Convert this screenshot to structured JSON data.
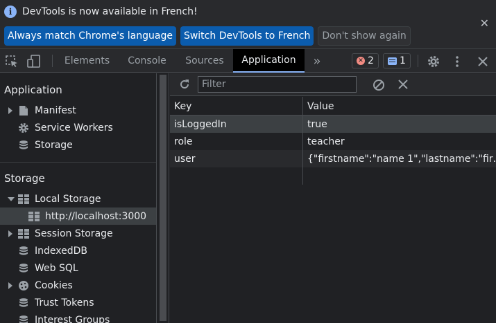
{
  "infobar": {
    "message": "DevTools is now available in French!",
    "buttons": {
      "match_language": "Always match Chrome's language",
      "switch_french": "Switch DevTools to French",
      "dont_show": "Don't show again"
    },
    "close_glyph": "✕"
  },
  "tabs": {
    "elements": "Elements",
    "console": "Console",
    "sources": "Sources",
    "application": "Application",
    "more": "»"
  },
  "badges": {
    "errors": "2",
    "messages": "1"
  },
  "sidebar": {
    "application_title": "Application",
    "application_items": [
      {
        "label": "Manifest",
        "icon": "document-icon"
      },
      {
        "label": "Service Workers",
        "icon": "gear-icon"
      },
      {
        "label": "Storage",
        "icon": "database-icon"
      }
    ],
    "storage_title": "Storage",
    "storage_items": [
      {
        "label": "Local Storage",
        "icon": "grid-icon"
      },
      {
        "label": "http://localhost:3000",
        "icon": "grid-icon"
      },
      {
        "label": "Session Storage",
        "icon": "grid-icon"
      },
      {
        "label": "IndexedDB",
        "icon": "database-icon"
      },
      {
        "label": "Web SQL",
        "icon": "database-icon"
      },
      {
        "label": "Cookies",
        "icon": "cookie-icon"
      },
      {
        "label": "Trust Tokens",
        "icon": "database-icon"
      },
      {
        "label": "Interest Groups",
        "icon": "database-icon"
      }
    ]
  },
  "toolbar": {
    "filter_placeholder": "Filter"
  },
  "table": {
    "headers": {
      "key": "Key",
      "value": "Value"
    },
    "rows": [
      {
        "key": "isLoggedIn",
        "value": "true"
      },
      {
        "key": "role",
        "value": "teacher"
      },
      {
        "key": "user",
        "value": "{\"firstname\":\"name 1\",\"lastname\":\"fir…"
      }
    ]
  },
  "colors": {
    "accent": "#8ab4f8",
    "error": "#f28b82",
    "primary_button": "#0b5cad"
  }
}
